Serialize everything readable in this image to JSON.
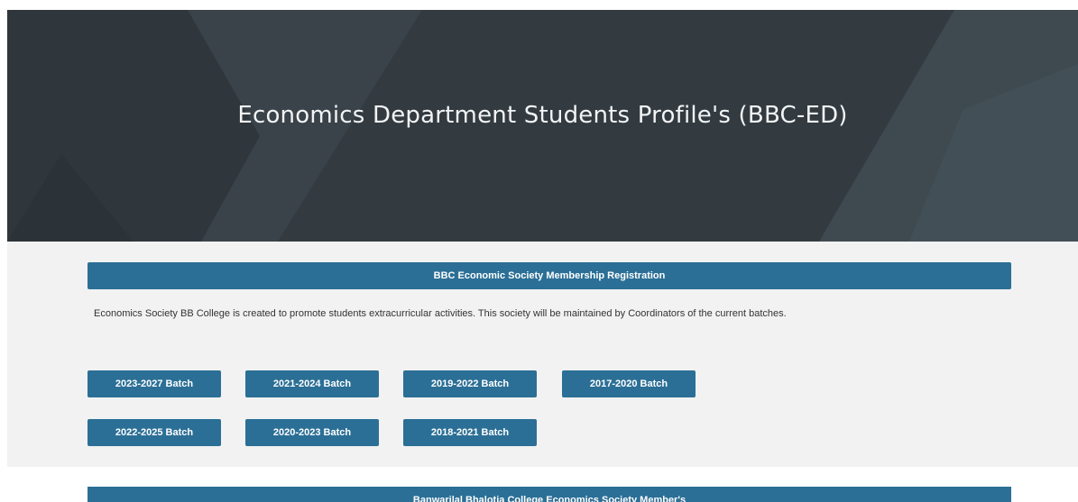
{
  "hero": {
    "title": "Economics Department Students Profile's (BBC-ED)"
  },
  "registration": {
    "label": "BBC Economic Society Membership Registration"
  },
  "description": "Economics Society BB College is created to promote students extracurricular activities.  This society will be maintained by Coordinators of the current batches.",
  "batches": {
    "row1": [
      "2023-2027 Batch",
      "2021-2024 Batch",
      "2019-2022 Batch",
      "2017-2020 Batch"
    ],
    "row2": [
      "2022-2025 Batch",
      "2020-2023 Batch",
      "2018-2021 Batch"
    ]
  },
  "members": {
    "label": "Banwarilal Bhalotia College Economics Society Member's"
  },
  "colors": {
    "hero_bg": "#353d44",
    "band_bg": "#f2f2f2",
    "button_bg": "#2b6f96",
    "button_text": "#ffffff"
  }
}
